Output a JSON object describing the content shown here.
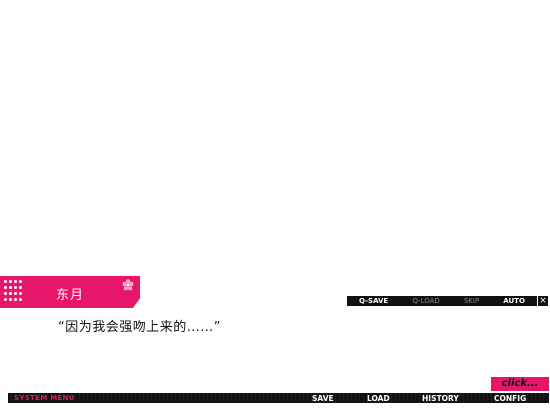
{
  "speaker": {
    "name": "东月"
  },
  "dialogue": {
    "text": "“因为我会强吻上来的……”"
  },
  "quick_menu": {
    "items": [
      {
        "label": "Q-SAVE",
        "dimmed": false
      },
      {
        "label": "Q-LOAD",
        "dimmed": true
      },
      {
        "label": "SKIP",
        "dimmed": true
      },
      {
        "label": "AUTO",
        "dimmed": false
      }
    ],
    "close_label": "×"
  },
  "click_prompt": {
    "label": "click..."
  },
  "system_menu": {
    "title": "SYSTEM MENU",
    "items": [
      {
        "label": "SAVE"
      },
      {
        "label": "LOAD"
      },
      {
        "label": "HISTORY"
      },
      {
        "label": "CONFIG"
      }
    ]
  },
  "colors": {
    "accent": "#e8166a",
    "bar": "#111111",
    "background": "#ffffff"
  }
}
